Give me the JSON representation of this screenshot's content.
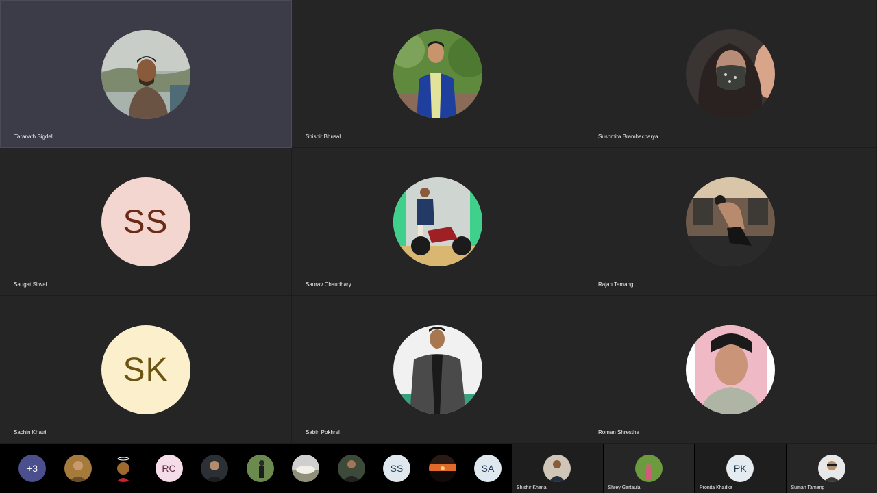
{
  "grid": {
    "tiles": [
      {
        "name": "Taranath Sigdel",
        "avatar": "photo",
        "initials": "",
        "active": true
      },
      {
        "name": "Shishir Bhusal",
        "avatar": "photo",
        "initials": ""
      },
      {
        "name": "Sushmita Bramhacharya",
        "avatar": "photo",
        "initials": ""
      },
      {
        "name": "Saugat Silwal",
        "avatar": "initials",
        "initials": "SS"
      },
      {
        "name": "Saurav Chaudhary",
        "avatar": "photo",
        "initials": ""
      },
      {
        "name": "Rajan Tamang",
        "avatar": "photo",
        "initials": ""
      },
      {
        "name": "Sachin Khatri",
        "avatar": "initials",
        "initials": "SK"
      },
      {
        "name": "Sabin Pokhrel",
        "avatar": "photo",
        "initials": ""
      },
      {
        "name": "Roman Shrestha",
        "avatar": "photo",
        "initials": ""
      }
    ]
  },
  "strip": {
    "overflow_label": "+3",
    "items": [
      {
        "type": "photo",
        "label": ""
      },
      {
        "type": "photo",
        "label": ""
      },
      {
        "type": "initials",
        "label": "RC"
      },
      {
        "type": "photo",
        "label": ""
      },
      {
        "type": "photo",
        "label": ""
      },
      {
        "type": "photo",
        "label": ""
      },
      {
        "type": "photo",
        "label": ""
      },
      {
        "type": "initials",
        "label": "SS"
      },
      {
        "type": "photo",
        "label": ""
      },
      {
        "type": "initials",
        "label": "SA"
      }
    ]
  },
  "speakers": [
    {
      "name": "Shishir Khanal",
      "avatar": "photo",
      "initials": ""
    },
    {
      "name": "Shrey Gartaula",
      "avatar": "photo",
      "initials": ""
    },
    {
      "name": "Pronita Khadka",
      "avatar": "initials",
      "initials": "PK"
    },
    {
      "name": "Suman Tamang",
      "avatar": "photo",
      "initials": ""
    }
  ],
  "colors": {
    "tile_bg": "#252525",
    "active_tile_bg": "#3c3c48",
    "ss_avatar_bg": "#f3d6cf",
    "ss_avatar_fg": "#6b2a17",
    "sk_avatar_bg": "#fcefcc",
    "sk_avatar_fg": "#6b5410",
    "overflow_bg": "#4b4f8e",
    "rc_avatar_bg": "#f4dce8",
    "rc_avatar_fg": "#5c2a44",
    "light_avatar_bg": "#dfe8ef",
    "light_avatar_fg": "#24405a",
    "pk_avatar_bg": "#e4ecf2",
    "pk_avatar_fg": "#1f3a52"
  }
}
